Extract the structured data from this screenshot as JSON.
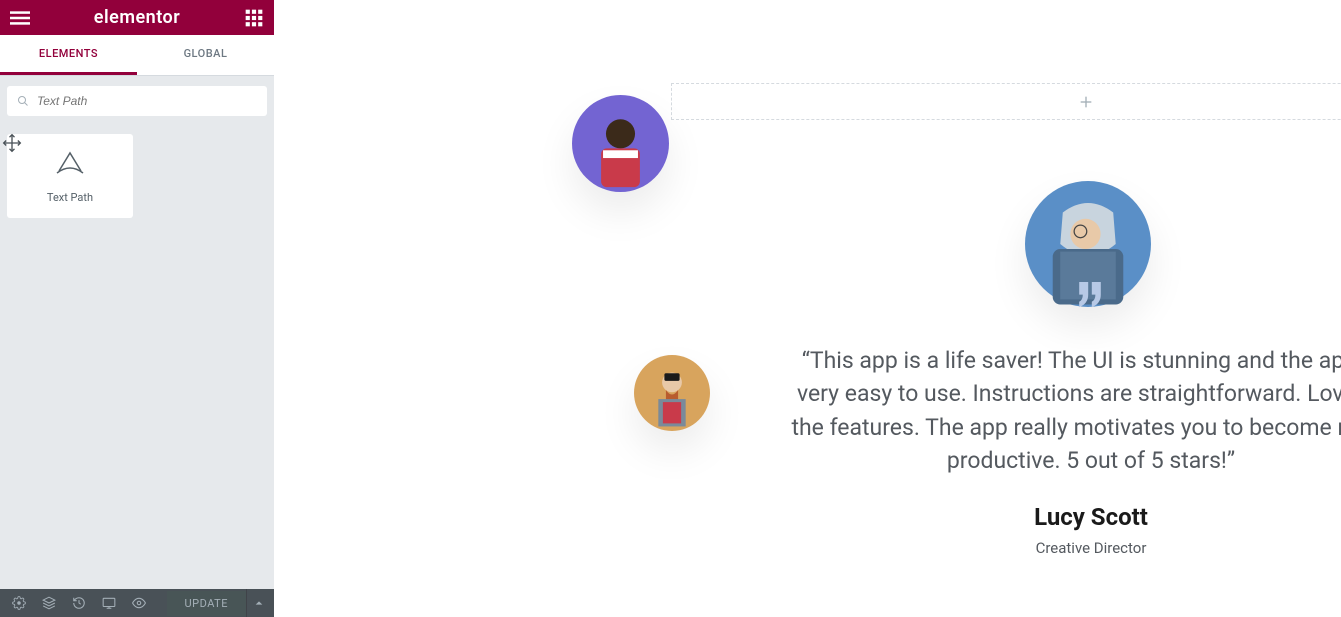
{
  "header": {
    "logo": "elementor"
  },
  "tabs": {
    "elements": "ELEMENTS",
    "global": "GLOBAL"
  },
  "search": {
    "placeholder": "Text Path"
  },
  "widget": {
    "label": "Text Path"
  },
  "footer": {
    "update": "UPDATE"
  },
  "testimonial": {
    "quote": "“This app is a life saver! The UI is stunning and the app is very easy to use. Instructions are straightforward. Love all the features. The app really motivates you to become more productive. 5 out of 5 stars!”",
    "name": "Lucy Scott",
    "role": "Creative Director"
  }
}
